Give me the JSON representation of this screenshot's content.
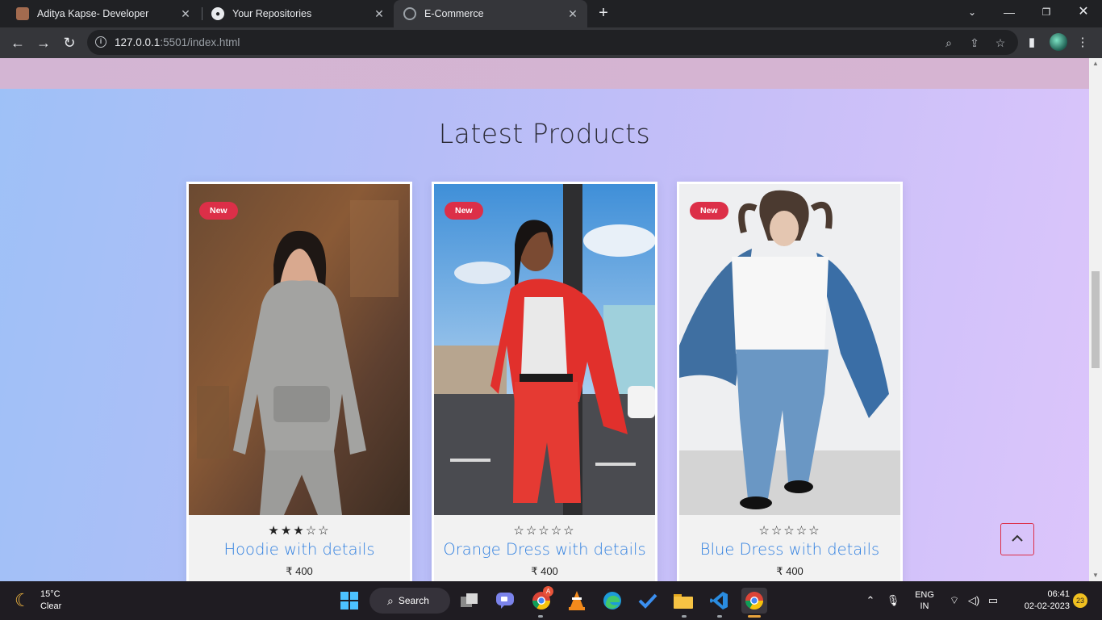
{
  "browser": {
    "tabs": [
      {
        "title": "Aditya Kapse- Developer",
        "active": false
      },
      {
        "title": "Your Repositories",
        "active": false
      },
      {
        "title": "E-Commerce",
        "active": true
      }
    ],
    "url_host": "127.0.0.1",
    "url_rest": ":5501/index.html"
  },
  "page": {
    "section_title": "Latest Products",
    "products": [
      {
        "badge": "New",
        "stars": "★★★☆☆",
        "name": "Hoodie with details",
        "price": "₹ 400"
      },
      {
        "badge": "New",
        "stars": "☆☆☆☆☆",
        "name": "Orange Dress with details",
        "price": "₹ 400"
      },
      {
        "badge": "New",
        "stars": "☆☆☆☆☆",
        "name": "Blue Dress with details",
        "price": "₹ 400"
      }
    ],
    "scroll_top_icon": "chevron-up-icon"
  },
  "taskbar": {
    "weather_temp": "15°C",
    "weather_cond": "Clear",
    "search_label": "Search",
    "lang_top": "ENG",
    "lang_bottom": "IN",
    "time": "06:41",
    "date": "02-02-2023",
    "notif_count": "23",
    "chrome_badge": "A"
  },
  "colors": {
    "accent_red": "#dc2f48",
    "link_blue": "#2f7fe0"
  }
}
